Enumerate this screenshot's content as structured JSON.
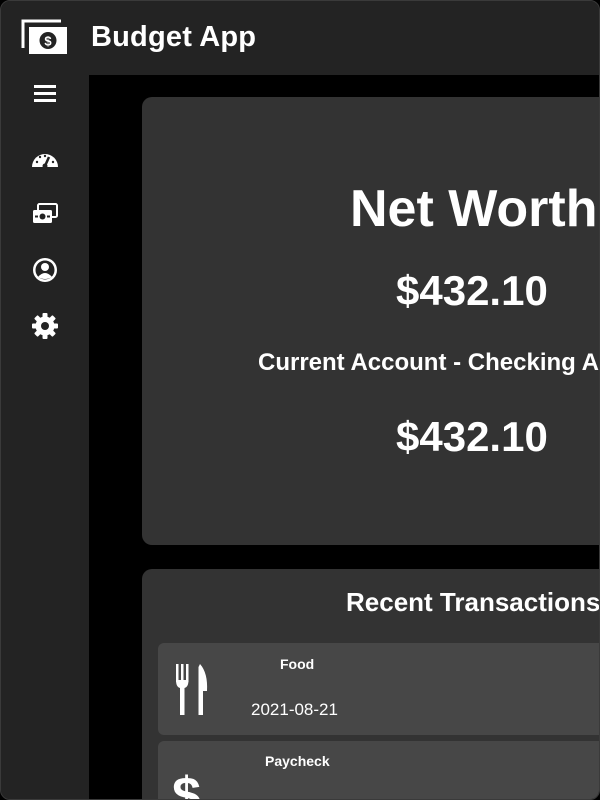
{
  "app": {
    "title": "Budget App",
    "logo_icon": "money-bill-dollar-icon"
  },
  "sidebar": {
    "items": [
      {
        "name": "menu",
        "icon": "hamburger-menu-icon"
      },
      {
        "name": "dashboard",
        "icon": "gauge-icon"
      },
      {
        "name": "accounts",
        "icon": "cards-icon"
      },
      {
        "name": "profile",
        "icon": "user-circle-icon"
      },
      {
        "name": "settings",
        "icon": "gear-icon"
      }
    ]
  },
  "net_worth": {
    "title": "Net Worth",
    "amount": "$432.10",
    "account_label": "Current Account - Checking Account",
    "account_amount": "$432.10"
  },
  "transactions": {
    "title": "Recent Transactions",
    "items": [
      {
        "category": "Food",
        "date": "2021-08-21",
        "icon": "fork-knife-icon"
      },
      {
        "category": "Paycheck",
        "date": "",
        "icon": "dollar-icon"
      }
    ]
  },
  "colors": {
    "background": "#000000",
    "panel": "#232323",
    "card": "#333333",
    "row": "#474747",
    "text": "#ffffff"
  }
}
